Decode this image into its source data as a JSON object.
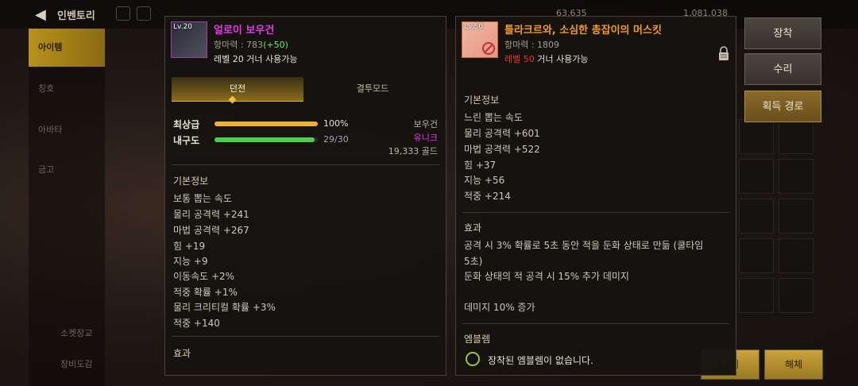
{
  "header": {
    "title": "인벤토리",
    "gold_amount": "1,081,038",
    "other_amount": "63,635"
  },
  "sidebar": {
    "tabs": [
      "아이템",
      "칭호",
      "아바타",
      "금고"
    ],
    "bottom": [
      "소켓장교",
      "장비도감"
    ]
  },
  "bottom_buttons": [
    "해체",
    "해체"
  ],
  "left_item": {
    "level_tag": "Lv.20",
    "name": "얼로이 보우건",
    "stat_label": "항마력 : 783",
    "stat_bonus": "(+50)",
    "requirement": "레벨 20 거너 사용가능",
    "mode_tabs": [
      "던전",
      "결투모드"
    ],
    "quality_label": "최상급",
    "quality_value": "100%",
    "quality_fraction": 1.0,
    "durability_label": "내구도",
    "durability_value": "29/30",
    "durability_fraction": 0.9667,
    "item_type": "보우건",
    "rarity": "유니크",
    "price": "19,333 골드",
    "basic_title": "기본정보",
    "basic_stats": [
      "보통 뽑는 속도",
      "물리 공격력 +241",
      "마법 공격력 +267",
      "힘 +19",
      "지능 +9",
      "이동속도 +2%",
      "적중 확률 +1%",
      "물리 크리티컬 확률 +3%",
      "적중 +140"
    ],
    "effect_title": "효과"
  },
  "right_item": {
    "level_tag": "Lv.50",
    "name": "틀라크르와, 소심한 총잡이의 머스킷",
    "stat_label": "항마력 : 1809",
    "requirement_level": "레벨 50",
    "requirement_rest": " 거너 사용가능",
    "basic_title": "기본정보",
    "basic_stats": [
      "느린 뽑는 속도",
      "물리 공격력 +601",
      "마법 공격력 +522",
      "힘 +37",
      "지능 +56",
      "적중 +214"
    ],
    "effect_title": "효과",
    "effect_lines": [
      "공격 시 3% 확률로 5초 동안 적을 둔화 상태로 만듦 (쿨타임",
      "5초)",
      "둔화 상태의 적 공격 시 15% 추가 데미지",
      "",
      "데미지 10% 증가"
    ],
    "emblem_title": "엠블렘",
    "emblem_text": "장착된 엠블렘이 없습니다."
  },
  "actions": {
    "equip": "장착",
    "repair": "수리",
    "acquire": "획득 경로"
  },
  "colors": {
    "magenta_name": "#e23ce8",
    "orange_name": "#f09a2a",
    "quality_bar": "#f0b030",
    "durability_bar": "#4bd04b"
  }
}
